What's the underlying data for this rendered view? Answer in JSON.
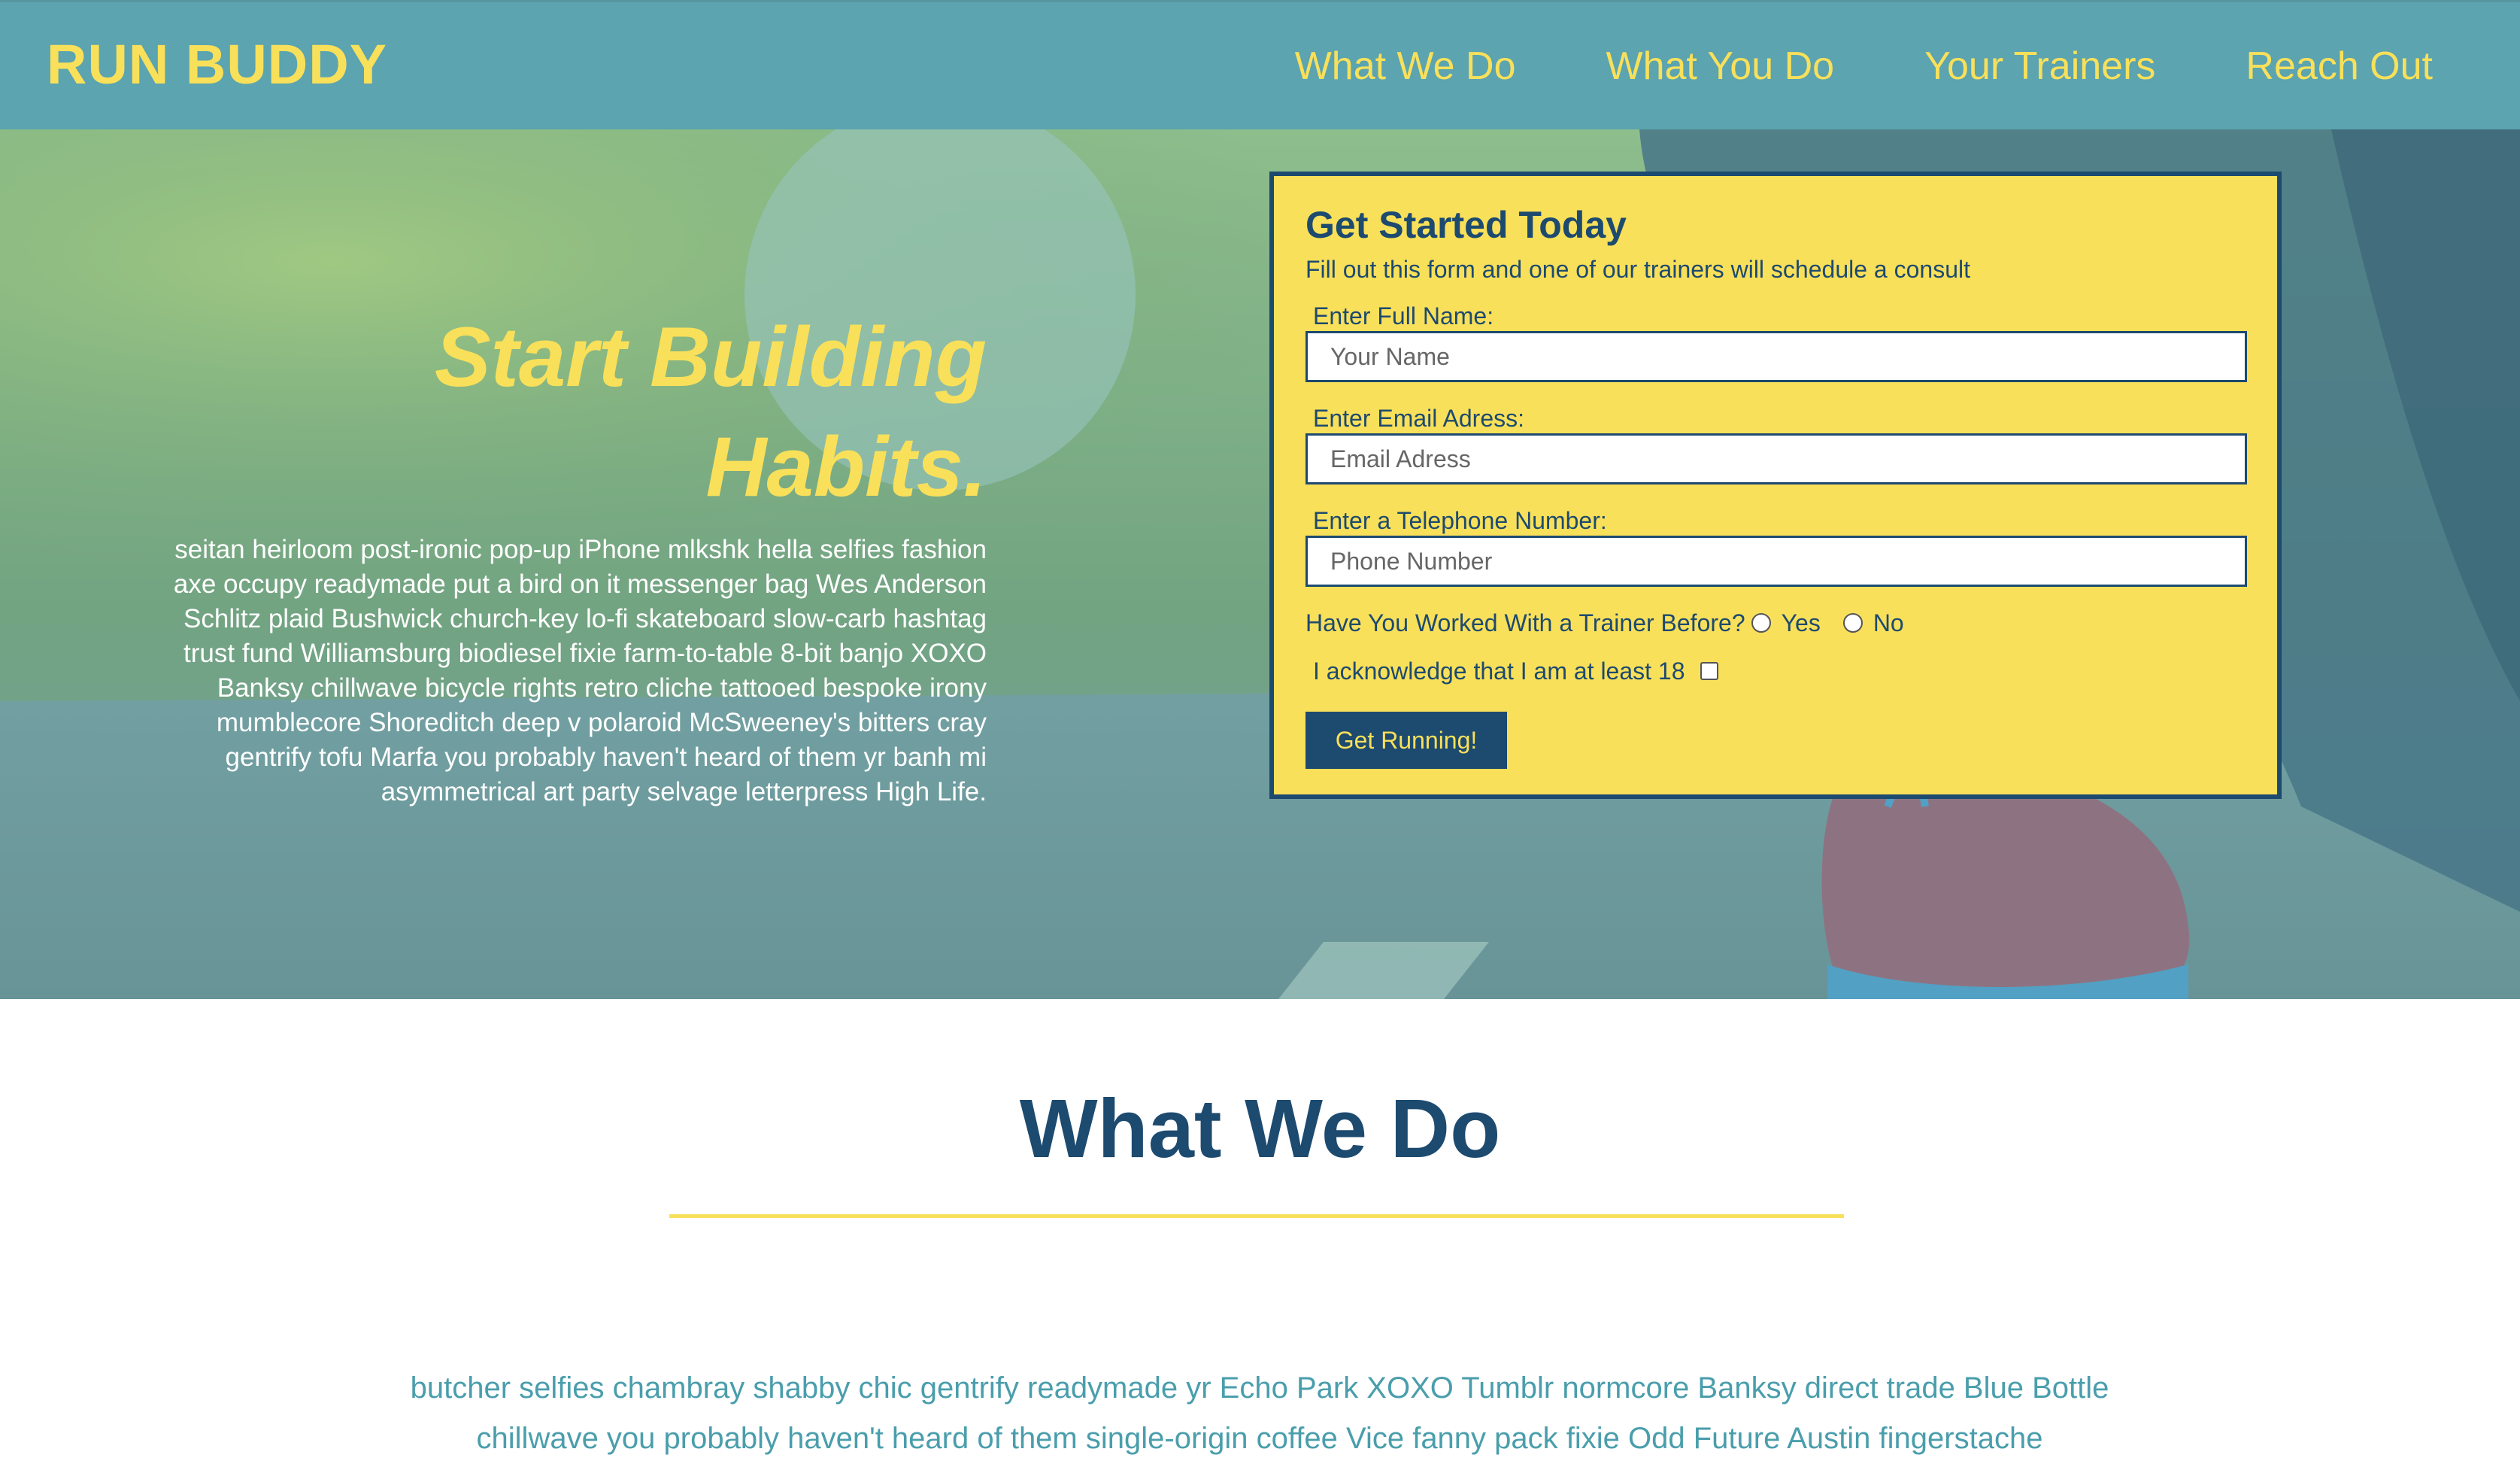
{
  "header": {
    "logo": "RUN BUDDY",
    "nav": [
      "What We Do",
      "What You Do",
      "Your Trainers",
      "Reach Out"
    ]
  },
  "hero": {
    "title_line1": "Start Building",
    "title_line2": "Habits.",
    "text": "seitan heirloom post-ironic pop-up iPhone mlkshk hella selfies fashion axe occupy readymade put a bird on it messenger bag Wes Anderson Schlitz plaid Bushwick church-key lo-fi skateboard slow-carb hashtag trust fund Williamsburg biodiesel fixie farm-to-table 8-bit banjo XOXO Banksy chillwave bicycle rights retro cliche tattooed bespoke irony mumblecore Shoreditch deep v polaroid McSweeney's bitters cray gentrify tofu Marfa you probably haven't heard of them yr banh mi asymmetrical art party selvage letterpress High Life."
  },
  "form": {
    "title": "Get Started Today",
    "subtitle": "Fill out this form and one of our trainers will schedule a consult",
    "name_label": "Enter Full Name:",
    "name_placeholder": "Your Name",
    "email_label": "Enter Email Adress:",
    "email_placeholder": "Email Adress",
    "phone_label": "Enter a Telephone Number:",
    "phone_placeholder": "Phone Number",
    "trainer_question": "Have You Worked With a Trainer Before?",
    "yes_label": "Yes",
    "no_label": "No",
    "age_label": "I acknowledge that I am at least 18",
    "submit_label": "Get Running!"
  },
  "what_we_do": {
    "title": "What We Do",
    "text": "butcher selfies chambray shabby chic gentrify readymade yr Echo Park XOXO Tumblr normcore Banksy direct trade Blue Bottle chillwave you probably haven't heard of them single-origin coffee Vice fanny pack fixie Odd Future Austin fingerstache"
  },
  "colors": {
    "header_bg": "#5ba4b0",
    "accent_yellow": "#f9e05a",
    "navy": "#1d4a6f",
    "teal_text": "#4a9eac"
  }
}
